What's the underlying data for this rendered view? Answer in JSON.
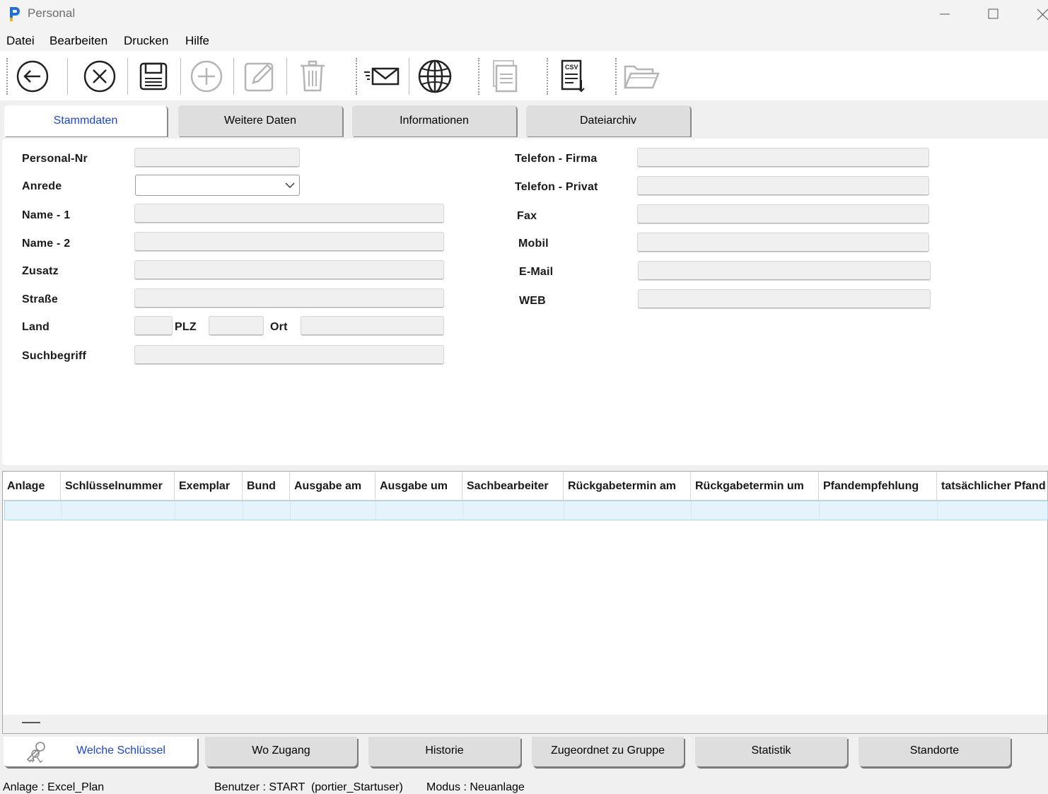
{
  "window": {
    "title": "Personal"
  },
  "menu": [
    "Datei",
    "Bearbeiten",
    "Drucken",
    "Hilfe"
  ],
  "toolbar": {
    "icons": [
      "back-icon",
      "cancel-icon",
      "save-icon",
      "add-icon",
      "edit-icon",
      "delete-icon",
      "email-icon",
      "web-icon",
      "copy-icon",
      "csv-export-icon",
      "open-folder-icon"
    ],
    "csv_text": "CSV"
  },
  "tabs_top": [
    {
      "label": "Stammdaten",
      "active": true
    },
    {
      "label": "Weitere Daten",
      "active": false
    },
    {
      "label": "Informationen",
      "active": false
    },
    {
      "label": "Dateiarchiv",
      "active": false
    }
  ],
  "form": {
    "personal_nr": {
      "label": "Personal-Nr",
      "value": ""
    },
    "anrede": {
      "label": "Anrede",
      "value": ""
    },
    "name1": {
      "label": "Name - 1",
      "value": ""
    },
    "name2": {
      "label": "Name - 2",
      "value": ""
    },
    "zusatz": {
      "label": "Zusatz",
      "value": ""
    },
    "strasse": {
      "label": "Straße",
      "value": ""
    },
    "land": {
      "label": "Land",
      "value": ""
    },
    "plz": {
      "label": "PLZ",
      "value": ""
    },
    "ort": {
      "label": "Ort",
      "value": ""
    },
    "suchbegriff": {
      "label": "Suchbegriff",
      "value": ""
    },
    "telefon_firma": {
      "label": "Telefon - Firma",
      "value": ""
    },
    "telefon_privat": {
      "label": "Telefon - Privat",
      "value": ""
    },
    "fax": {
      "label": "Fax",
      "value": ""
    },
    "mobil": {
      "label": "Mobil",
      "value": ""
    },
    "email": {
      "label": "E-Mail",
      "value": ""
    },
    "web": {
      "label": "WEB",
      "value": ""
    }
  },
  "grid": {
    "columns": [
      "Anlage",
      "Schlüsselnummer",
      "Exemplar",
      "Bund",
      "Ausgabe am",
      "Ausgabe um",
      "Sachbearbeiter",
      "Rückgabetermin am",
      "Rückgabetermin um",
      "Pfandempfehlung",
      "tatsächlicher Pfand"
    ],
    "rows": []
  },
  "tabs_bottom": [
    {
      "label": "Welche Schlüssel",
      "active": true,
      "icon": "keys-icon"
    },
    {
      "label": "Wo Zugang",
      "active": false
    },
    {
      "label": "Historie",
      "active": false
    },
    {
      "label": "Zugeordnet zu Gruppe",
      "active": false
    },
    {
      "label": "Statistik",
      "active": false
    },
    {
      "label": "Standorte",
      "active": false
    }
  ],
  "status": {
    "anlage": "Anlage : Excel_Plan",
    "benutzer": "Benutzer : START  (portier_Startuser)",
    "modus": "Modus : Neuanlage"
  },
  "colors": {
    "accent": "#1c46d6",
    "selection": "#e5f3fb"
  }
}
